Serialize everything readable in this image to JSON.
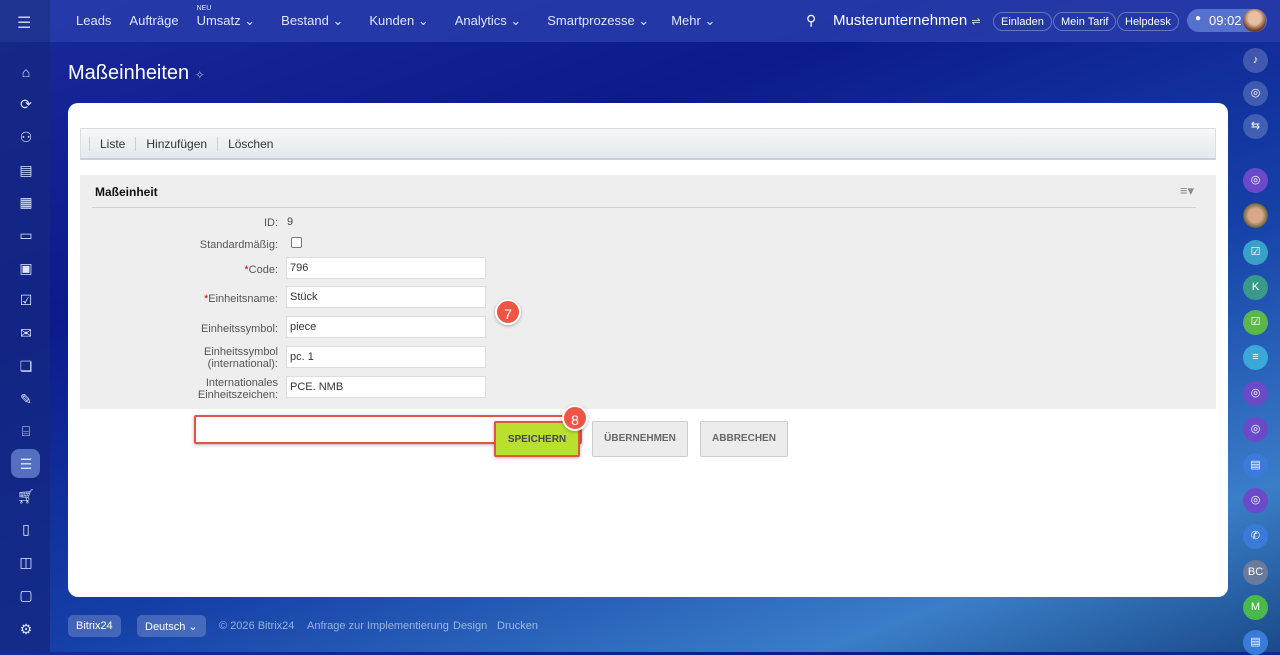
{
  "topbar": {
    "nav": [
      "Leads",
      "Aufträge",
      "Umsatz",
      "Bestand",
      "Kunden",
      "Analytics",
      "Smartprozesse",
      "Mehr"
    ],
    "neu_badge": "NEU",
    "company": "Musterunternehmen",
    "invite": "Einladen",
    "plan": "Mein Tarif",
    "helpdesk": "Helpdesk",
    "time": "09:02"
  },
  "page": {
    "title": "Maßeinheiten"
  },
  "toolbar": {
    "list": "Liste",
    "add": "Hinzufügen",
    "delete": "Löschen"
  },
  "form": {
    "section": "Maßeinheit",
    "id_label": "ID:",
    "id_value": "9",
    "default_label": "Standardmäßig:",
    "default_checked": false,
    "code_label": "Code:",
    "code_value": "796",
    "name_label": "Einheitsname:",
    "name_value": "Stück",
    "symbol_label": "Einheitssymbol:",
    "symbol_value": "piece",
    "symbol_intl_label1": "Einheitssymbol",
    "symbol_intl_label2": "(international):",
    "symbol_intl_value": "pc. 1",
    "intl_label1": "Internationales",
    "intl_label2": "Einheitszeichen:",
    "intl_value": "PCE. NMB",
    "required_mark": "*"
  },
  "buttons": {
    "save": "SPEICHERN",
    "apply": "ÜBERNEHMEN",
    "cancel": "ABBRECHEN"
  },
  "annotations": {
    "step7": "7",
    "step8": "8"
  },
  "right_sidebar": {
    "k": "K",
    "bc": "BC",
    "m": "M"
  },
  "footer": {
    "brand": "Bitrix24",
    "language": "Deutsch",
    "copyright": "© 2026 Bitrix24",
    "implementation": "Anfrage zur Implementierung",
    "design": "Design",
    "print": "Drucken"
  }
}
